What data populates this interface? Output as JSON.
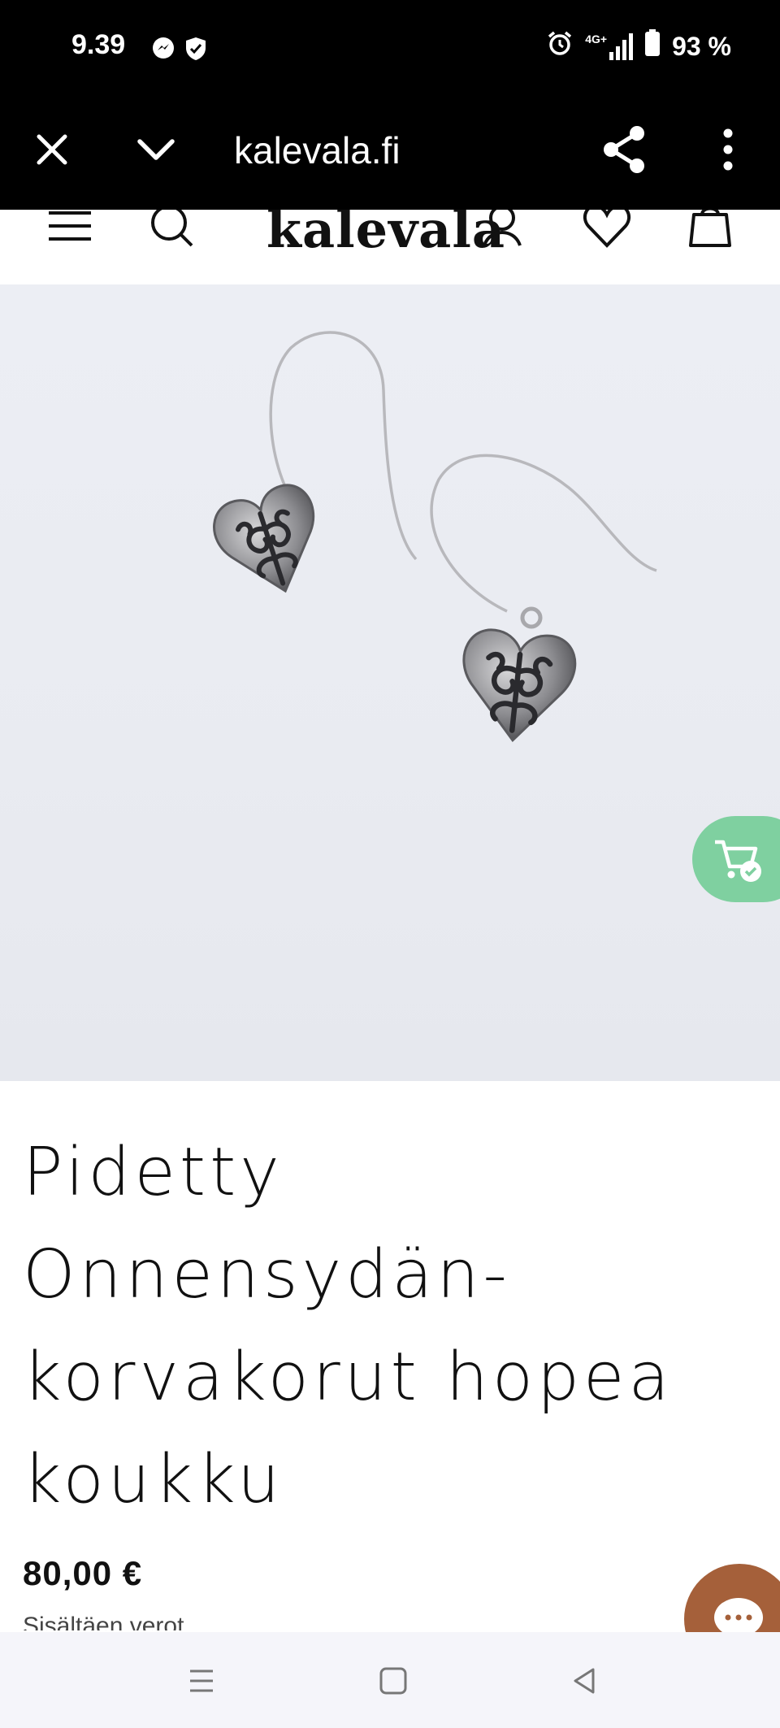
{
  "status_bar": {
    "time": "9.39",
    "battery": "93 %",
    "network": "4G+",
    "left_icons": [
      "messenger-icon",
      "shield-icon"
    ],
    "right_icons": [
      "alarm-icon",
      "signal-icon",
      "battery-icon"
    ]
  },
  "browser": {
    "url": "kalevala.fi",
    "icons": [
      "close-icon",
      "chevron-down-icon",
      "share-icon",
      "more-vert-icon"
    ]
  },
  "site_header": {
    "logo": "kalevala",
    "icons": [
      "menu-icon",
      "search-icon",
      "user-icon",
      "heart-icon",
      "bag-icon"
    ]
  },
  "product": {
    "title": "Pidetty Onnensydän-korvakorut hopea koukku",
    "title_lines": [
      "Pidetty",
      "Onnensydän-",
      "korvakorut hopea",
      "koukku"
    ],
    "price": "80,00 €",
    "tax_note": "Sisältäen verot",
    "image_description_icon": "earrings-image"
  },
  "floating": {
    "cart_icon": "cart-check-icon",
    "chat_icon": "chat-icon",
    "cart_color": "#7fd0a0",
    "chat_color": "#a5603a"
  },
  "nav_bar": {
    "icons": [
      "recent-apps-icon",
      "home-icon",
      "back-icon"
    ]
  }
}
